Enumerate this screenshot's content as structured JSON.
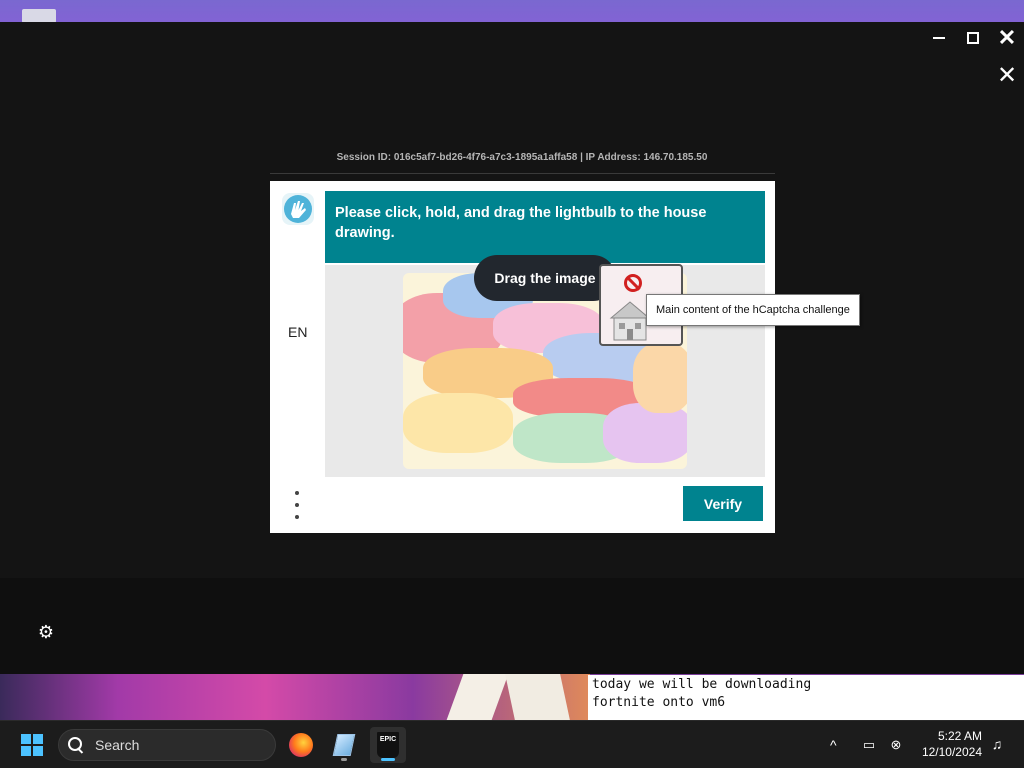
{
  "window": {
    "close_glyph": "✕",
    "inner_close_glyph": "✕"
  },
  "session": {
    "text": "Session ID: 016c5af7-bd26-4f76-a7c3-1895a1affa58 | IP Address: 146.70.185.50"
  },
  "captcha": {
    "language": "EN",
    "prompt": "Please click, hold, and drag the lightbulb to the house drawing.",
    "drag_hint": "Drag the image",
    "tooltip": "Main content of the hCaptcha challenge",
    "verify_label": "Verify",
    "accent_color": "#00838f"
  },
  "terminal": {
    "lines": [
      "today we will be downloading",
      "fortnite onto vm6"
    ]
  },
  "taskbar": {
    "search_label": "Search",
    "apps": [
      "firefox-icon",
      "vm-icon",
      "epic-games-icon"
    ],
    "epic_label": "EPIC",
    "time": "5:22 AM",
    "date": "12/10/2024"
  }
}
